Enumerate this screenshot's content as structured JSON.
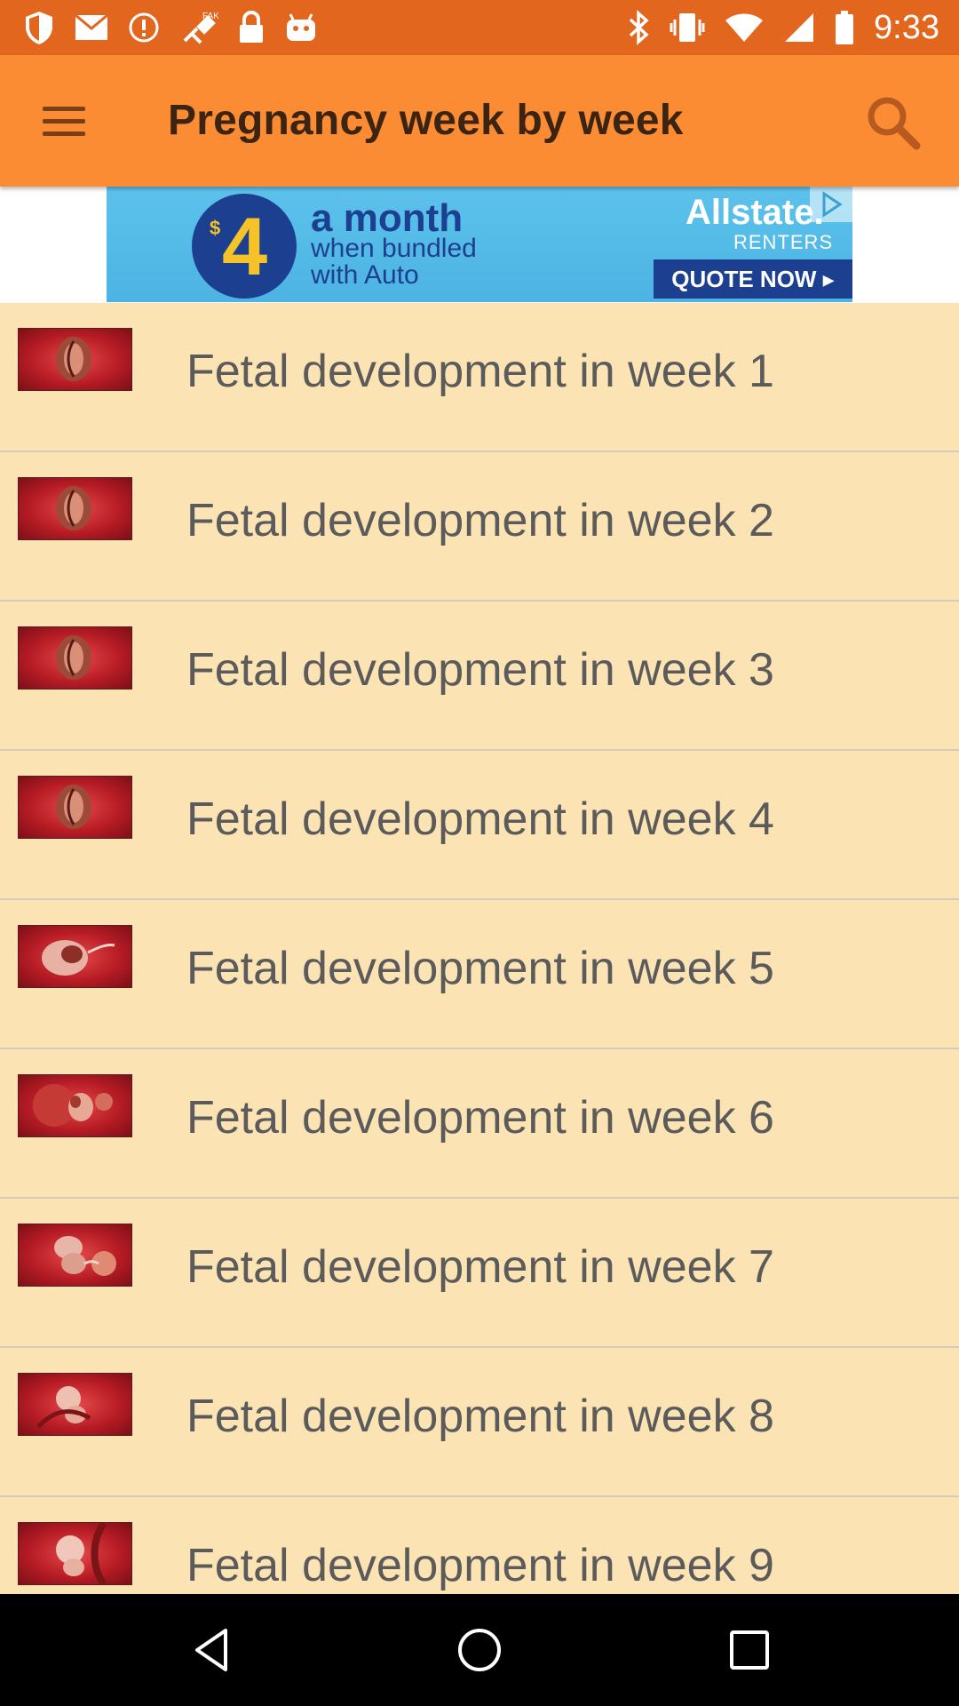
{
  "status_bar": {
    "time": "9:33",
    "left_icons": [
      "shield-icon",
      "mail-icon",
      "alert-icon",
      "fake-gps-icon",
      "lock-icon",
      "android-icon"
    ],
    "right_icons": [
      "bluetooth-icon",
      "vibrate-icon",
      "wifi-icon",
      "signal-icon",
      "battery-icon"
    ]
  },
  "app_bar": {
    "title": "Pregnancy week by week",
    "menu_icon": "hamburger-menu-icon",
    "search_icon": "search-icon",
    "background": "#fb8c34",
    "status_color": "#e2661d"
  },
  "ad": {
    "dollar": "$",
    "amount": "4",
    "line1": "a month",
    "line2": "when bundled",
    "line3": "with Auto",
    "brand": "Allstate.",
    "sub": "RENTERS",
    "cta": "QUOTE NOW ▸"
  },
  "weeks": [
    {
      "label": "Fetal development in week 1"
    },
    {
      "label": "Fetal development in week 2"
    },
    {
      "label": "Fetal development in week 3"
    },
    {
      "label": "Fetal development in week 4"
    },
    {
      "label": "Fetal development in week 5"
    },
    {
      "label": "Fetal development in week 6"
    },
    {
      "label": "Fetal development in week 7"
    },
    {
      "label": "Fetal development in week 8"
    },
    {
      "label": "Fetal development in week 9"
    }
  ],
  "nav_bar": {
    "back_icon": "back-triangle-icon",
    "home_icon": "home-circle-icon",
    "recents_icon": "recents-square-icon"
  }
}
